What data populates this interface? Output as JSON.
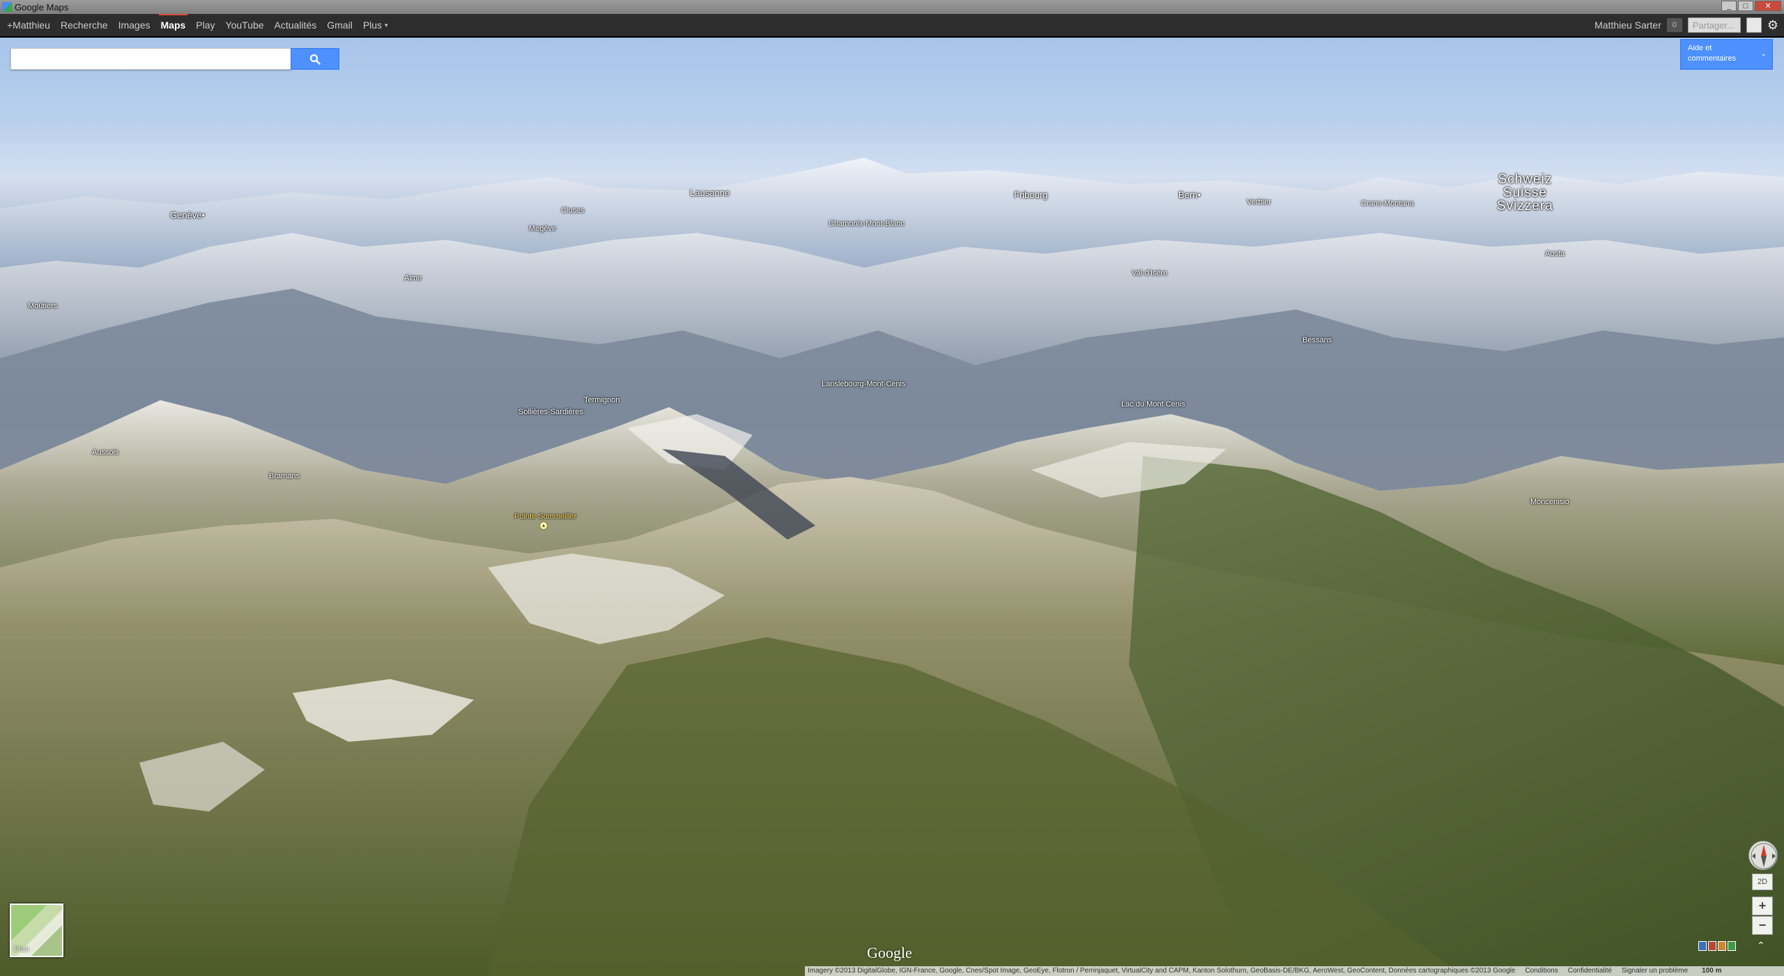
{
  "window": {
    "title": "Google Maps",
    "controls": [
      "_",
      "□",
      "✕"
    ]
  },
  "gbar": {
    "nav": [
      {
        "label": "+Matthieu",
        "active": false
      },
      {
        "label": "Recherche",
        "active": false
      },
      {
        "label": "Images",
        "active": false
      },
      {
        "label": "Maps",
        "active": true
      },
      {
        "label": "Play",
        "active": false
      },
      {
        "label": "YouTube",
        "active": false
      },
      {
        "label": "Actualités",
        "active": false
      },
      {
        "label": "Gmail",
        "active": false
      },
      {
        "label": "Plus",
        "active": false
      }
    ],
    "more_caret": "▾",
    "user_name": "Matthieu Sarter",
    "notification_count": "0",
    "share_placeholder": "Partager...",
    "settings_icon": "gear-icon"
  },
  "search": {
    "value": "",
    "placeholder": "",
    "button_icon": "search-icon"
  },
  "help": {
    "label_line1": "Aide et",
    "label_line2": "commentaires",
    "chevron": "⌄"
  },
  "places": [
    {
      "name": "Genève",
      "dot": true
    },
    {
      "name": "Lausanne"
    },
    {
      "name": "Cluses"
    },
    {
      "name": "Megève"
    },
    {
      "name": "Chamonix-Mont-Blanc"
    },
    {
      "name": "Fribourg"
    },
    {
      "name": "Bern",
      "dot": true
    },
    {
      "name": "Verbier"
    },
    {
      "name": "Crans-Montana"
    },
    {
      "name": "Aime"
    },
    {
      "name": "Moûtiers"
    },
    {
      "name": "Val-d'Isère"
    },
    {
      "name": "Aosta"
    },
    {
      "name": "Bessans"
    },
    {
      "name": "Termignon"
    },
    {
      "name": "Sollières-Sardières"
    },
    {
      "name": "Lanslebourg-Mont-Cenis"
    },
    {
      "name": "Lac du Mont Cenis"
    },
    {
      "name": "Aussois"
    },
    {
      "name": "Bramans"
    },
    {
      "name": "Moncenisio"
    },
    {
      "name": "Pointe Sommeiller"
    }
  ],
  "country_label": {
    "line1": "Schweiz",
    "line2": "Suisse",
    "line3": "Svizzera"
  },
  "controls": {
    "tilt_label": "2D",
    "zoom_in": "+",
    "zoom_out": "−",
    "expand": "⌃"
  },
  "plan_thumbnail": {
    "label": "Plan"
  },
  "logo": {
    "text": "Google"
  },
  "footer": {
    "attribution": "Imagery ©2013 DigitalGlobe, IGN-France, Google, Cnes/Spot Image, GeoEye, Flotron / Perrinjaquet, VirtualCity and CAPM, Kanton Solothurn, GeoBasis-DE/BKG, AeroWest, GeoContent, Données cartographiques ©2013 Google",
    "conditions": "Conditions",
    "privacy": "Confidentialité",
    "report": "Signaler un problème",
    "scale": "100 m"
  }
}
